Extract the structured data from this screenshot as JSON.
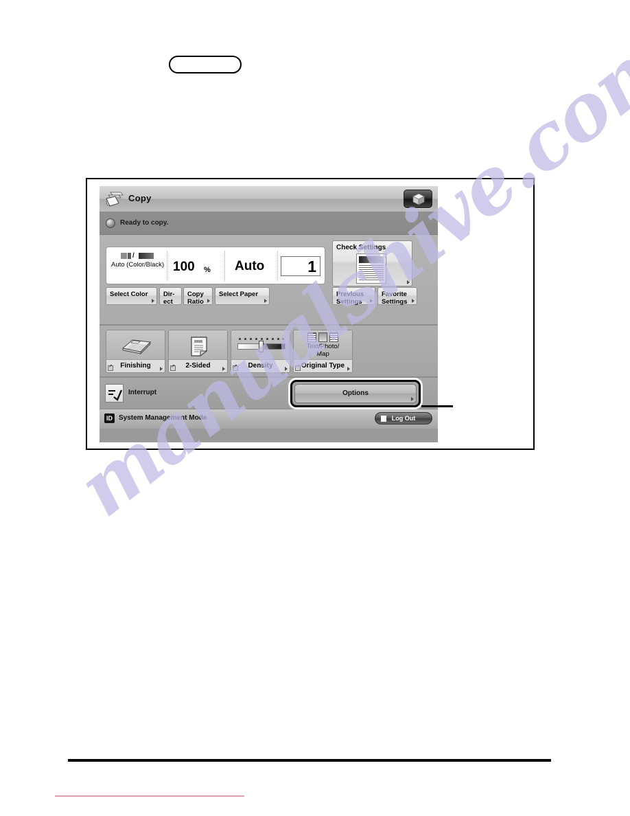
{
  "document": {
    "heading_pill": "",
    "page_rule": "horizontal-rule",
    "footer_rule": "redacted-footer-line"
  },
  "watermark": {
    "text": "manualshive.com",
    "color": "#bdbbe4"
  },
  "panel": {
    "titlebar": {
      "app_title": "Copy",
      "app_icon": "copy-documents-icon",
      "cube_button_icon": "3d-cube-icon"
    },
    "statusbar": {
      "status_icon": "status-indicator-icon",
      "status_text": "Ready to copy."
    },
    "readout": {
      "color_mode": {
        "icon": "color-black-swatch-icon",
        "separator": "/",
        "label": "Auto\n(Color/Black)"
      },
      "copy_ratio": {
        "value": "100",
        "unit": "%"
      },
      "paper": {
        "value": "Auto"
      },
      "copies": {
        "value": "1"
      }
    },
    "setting_tabs": [
      {
        "label": "Select Color",
        "name": "select-color"
      },
      {
        "label": "Dir-\nect",
        "name": "direct"
      },
      {
        "label": "Copy\nRatio",
        "name": "copy-ratio"
      },
      {
        "label": "Select Paper",
        "name": "select-paper"
      }
    ],
    "check_settings": {
      "title": "Check Settings",
      "preview_icon": "document-preview-icon"
    },
    "right_tabs": [
      {
        "label": "Previous\nSettings",
        "name": "previous-settings"
      },
      {
        "label": "Favorite\nSettings",
        "name": "favorite-settings"
      }
    ],
    "function_buttons": [
      {
        "label": "Finishing",
        "icon": "stacked-paper-finishing-icon"
      },
      {
        "label": "2-Sided",
        "icon": "two-sided-page-icon"
      },
      {
        "label": "Density",
        "icon": "density-slider-icon"
      },
      {
        "label": "Original Type",
        "icon": "original-type-icon",
        "caption": "Text/Photo/\nMap"
      }
    ],
    "interrupt": {
      "label": "Interrupt",
      "icon": "interrupt-icon"
    },
    "options": {
      "label": "Options",
      "highlighted": true
    },
    "footer": {
      "id_badge": "ID",
      "mode_text": "System Management Mode",
      "logout_label": "Log Out",
      "logout_icon": "logout-icon"
    }
  }
}
